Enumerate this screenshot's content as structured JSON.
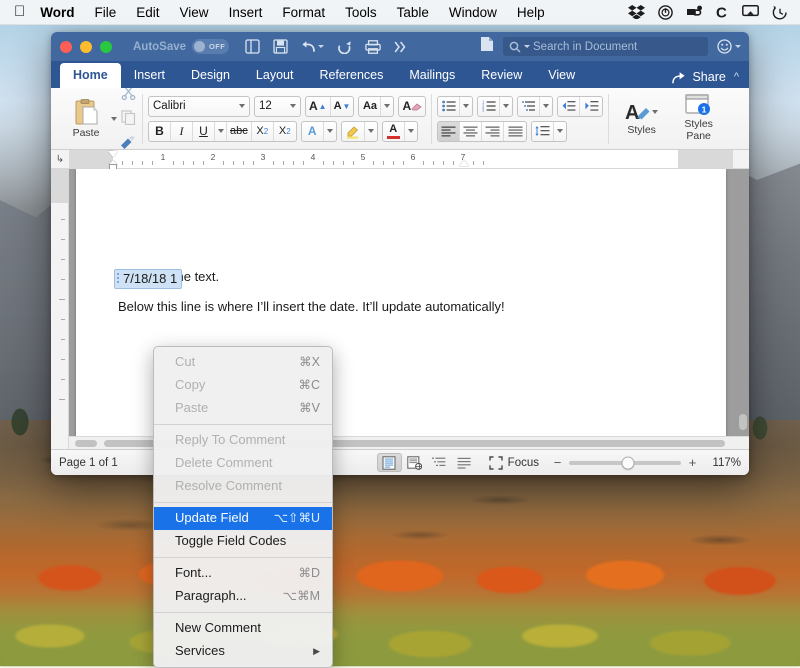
{
  "menubar": {
    "apple_icon": "apple-logo",
    "items": [
      {
        "label": "Word",
        "bold": true
      },
      {
        "label": "File"
      },
      {
        "label": "Edit"
      },
      {
        "label": "View"
      },
      {
        "label": "Insert"
      },
      {
        "label": "Format"
      },
      {
        "label": "Tools"
      },
      {
        "label": "Table"
      },
      {
        "label": "Window"
      },
      {
        "label": "Help"
      }
    ],
    "status_icons": [
      "dropbox-icon",
      "onedrive-circle-icon",
      "caffeine-icon",
      "c-letter-icon",
      "airplay-icon",
      "time-machine-icon"
    ]
  },
  "window": {
    "titlebar": {
      "autosave_label": "AutoSave",
      "autosave_state": "OFF",
      "quick_access": [
        "new-document-icon",
        "save-icon",
        "undo-icon",
        "redo-icon",
        "print-icon",
        "more-chevrons-icon"
      ],
      "doc_icon": "document-icon"
    },
    "search": {
      "placeholder": "Search in Document",
      "icon": "search-icon"
    },
    "smiley": {
      "icon": "smiley-face-icon"
    },
    "tabs": [
      {
        "label": "Home",
        "active": true
      },
      {
        "label": "Insert",
        "active": false
      },
      {
        "label": "Design",
        "active": false
      },
      {
        "label": "Layout",
        "active": false
      },
      {
        "label": "References",
        "active": false
      },
      {
        "label": "Mailings",
        "active": false
      },
      {
        "label": "Review",
        "active": false
      },
      {
        "label": "View",
        "active": false
      }
    ],
    "share_label": "Share",
    "ribbon": {
      "paste_label": "Paste",
      "font_name": "Calibri",
      "font_size": "12",
      "grow_font": "A",
      "shrink_font": "A",
      "change_case": "Aa",
      "clear_format": "A",
      "bold": "B",
      "italic": "I",
      "underline": "U",
      "strikethrough": "abc",
      "subscript": "X",
      "subscript_sub": "2",
      "superscript": "X",
      "superscript_sup": "2",
      "text_effects": "A",
      "highlight": "highlighter-icon",
      "font_color": "A",
      "styles_label": "Styles",
      "styles_pane_label": "Styles Pane",
      "styles_pane_badge": "1"
    },
    "ruler": {
      "numbers": [
        "1",
        "2",
        "3",
        "4",
        "5",
        "6",
        "7"
      ]
    },
    "document": {
      "line1": "This is some text.",
      "line2": "Below this line is where I’ll insert the date. It’ll update automatically!",
      "date_field": "7/18/18 1"
    },
    "statusbar": {
      "page_label": "Page 1 of 1",
      "focus_label": "Focus",
      "zoom_percent": "117%",
      "zoom_minus": "−",
      "zoom_plus": "+",
      "view_buttons": [
        "print-layout-icon",
        "web-layout-icon",
        "outline-icon",
        "draft-icon"
      ]
    }
  },
  "context_menu": {
    "items": [
      {
        "label": "Cut",
        "shortcut": "⌘X",
        "state": "disabled"
      },
      {
        "label": "Copy",
        "shortcut": "⌘C",
        "state": "disabled"
      },
      {
        "label": "Paste",
        "shortcut": "⌘V",
        "state": "disabled"
      },
      {
        "separator": true
      },
      {
        "label": "Reply To Comment",
        "shortcut": "",
        "state": "disabled"
      },
      {
        "label": "Delete Comment",
        "shortcut": "",
        "state": "disabled"
      },
      {
        "label": "Resolve Comment",
        "shortcut": "",
        "state": "disabled"
      },
      {
        "separator": true
      },
      {
        "label": "Update Field",
        "shortcut": "⌥⇧⌘U",
        "state": "highlighted"
      },
      {
        "label": "Toggle Field Codes",
        "shortcut": "",
        "state": "normal"
      },
      {
        "separator": true
      },
      {
        "label": "Font...",
        "shortcut": "⌘D",
        "state": "normal"
      },
      {
        "label": "Paragraph...",
        "shortcut": "⌥⌘M",
        "state": "normal"
      },
      {
        "separator": true
      },
      {
        "label": "New Comment",
        "shortcut": "",
        "state": "normal"
      },
      {
        "label": "Services",
        "shortcut": "▶",
        "state": "normal",
        "submenu": true
      }
    ]
  },
  "colors": {
    "titlebar_blue": "#41689f",
    "ribbon_tabs_blue": "#2e5693",
    "menu_highlight": "#1a72e8",
    "field_highlight": "#cfe2f5"
  }
}
